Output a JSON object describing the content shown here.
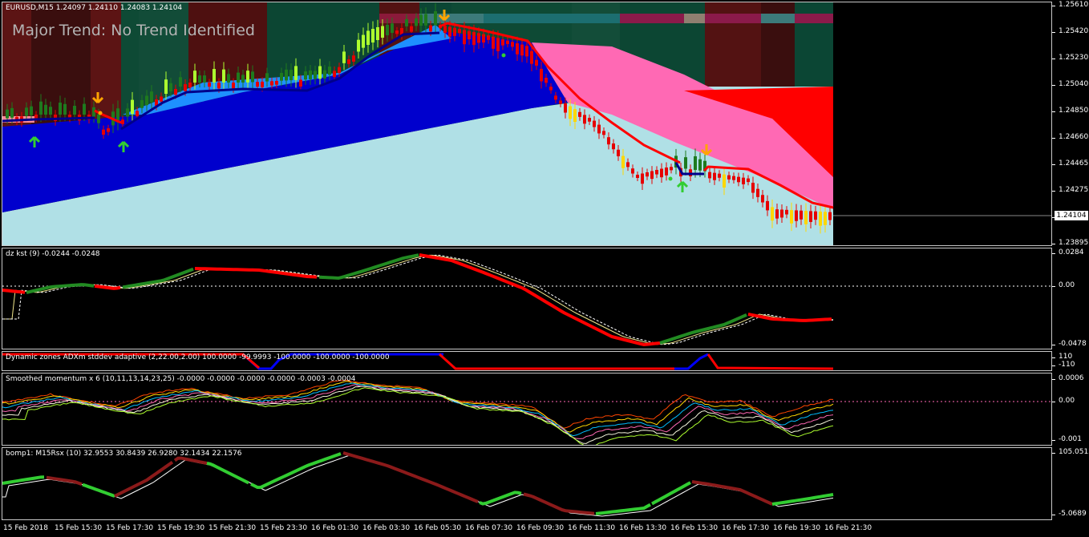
{
  "main": {
    "symbol_label": "EURUSD,M15  1.24097 1.24110 1.24083 1.24104",
    "trend_text": "Major Trend: No Trend Identified",
    "current_price": "1.24104",
    "price_ticks": [
      "1.25610",
      "1.25420",
      "1.25230",
      "1.25040",
      "1.24850",
      "1.24660",
      "1.24465",
      "1.24275",
      "1.24085",
      "1.23895"
    ]
  },
  "kst": {
    "label": "dz kst (9) -0.0244 -0.0248",
    "ticks": [
      "0.0284",
      "0.00",
      "-0.0478"
    ]
  },
  "adx": {
    "label": "Dynamic zones ADXm stddev adaptive (2,22.00,2.00) 100.0000 -99.9993 -100.0000 -100.0000 -100.0000",
    "ticks": [
      "110",
      "-110"
    ]
  },
  "momentum": {
    "label": "Smoothed momentum x 6 (10,11,13,14,23,25) -0.0000 -0.0000 -0.0000 -0.0000 -0.0003 -0.0004",
    "ticks": [
      "0.0006",
      "0.00",
      "-0.001"
    ]
  },
  "rsx": {
    "label": "bomp1: M15Rsx (10) 32.9553 30.8439 26.9280 32.1434 22.1576",
    "ticks": [
      "105.0512",
      "-5.0689"
    ]
  },
  "time_labels": [
    "15 Feb 2018",
    "15 Feb 15:30",
    "15 Feb 17:30",
    "15 Feb 19:30",
    "15 Feb 21:30",
    "15 Feb 23:30",
    "16 Feb 01:30",
    "16 Feb 03:30",
    "16 Feb 05:30",
    "16 Feb 07:30",
    "16 Feb 09:30",
    "16 Feb 11:30",
    "16 Feb 13:30",
    "16 Feb 15:30",
    "16 Feb 17:30",
    "16 Feb 19:30",
    "16 Feb 21:30"
  ],
  "colors": {
    "bull_candle": "#1e7a1e",
    "bear_candle": "#e60000",
    "trend_line_up": "#00008b",
    "trend_line_down": "#ff0000",
    "channel_dark": "#0000cd",
    "channel_light": "#b0e0e6",
    "channel_mid": "#1e90ff",
    "channel_pink": "#ff69b4",
    "up_arrow": "#32cd32",
    "down_arrow": "#ffa500"
  },
  "chart_data": [
    {
      "type": "line",
      "title": "EURUSD,M15",
      "y_range": [
        1.23895,
        1.2561
      ],
      "series": [
        {
          "name": "",
          "x": [
            0,
            10,
            20,
            30,
            40,
            50,
            60,
            70,
            80,
            90,
            100,
            110,
            120,
            130,
            140,
            150,
            160
          ],
          "values": [
            1.2482,
            1.2483,
            1.247,
            1.249,
            1.2502,
            1.2505,
            1.2503,
            1.2508,
            1.252,
            1.2538,
            1.2547,
            1.254,
            1.2533,
            1.2512,
            1.247,
            1.2448,
            1.2438
          ]
        }
      ]
    },
    {
      "type": "line",
      "title": "dz kst (9)",
      "y_range": [
        -0.0478,
        0.0284
      ]
    },
    {
      "type": "line",
      "title": "Dynamic zones ADXm stddev adaptive",
      "y_range": [
        -110,
        110
      ]
    },
    {
      "type": "line",
      "title": "Smoothed momentum x 6",
      "y_range": [
        -0.001,
        0.0006
      ]
    },
    {
      "type": "line",
      "title": "bomp1: M15Rsx (10)",
      "y_range": [
        -5.0689,
        105.0512
      ]
    }
  ]
}
